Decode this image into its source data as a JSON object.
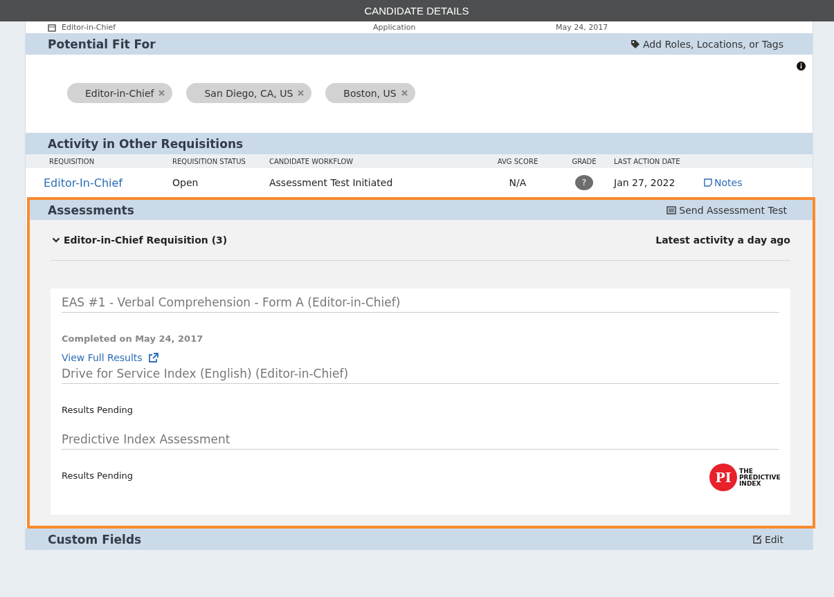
{
  "header": {
    "title": "CANDIDATE DETAILS"
  },
  "top_row": {
    "requisition": "Editor-in-Chief",
    "stage": "Application",
    "date": "May 24, 2017"
  },
  "potential_fit": {
    "title": "Potential Fit For",
    "action": "Add Roles, Locations, or Tags",
    "tags": [
      {
        "label": "Editor-in-Chief"
      },
      {
        "label": "San Diego, CA, US"
      },
      {
        "label": "Boston, US"
      }
    ]
  },
  "activity": {
    "title": "Activity in Other Requisitions",
    "columns": [
      "REQUISITION",
      "REQUISITION STATUS",
      "CANDIDATE WORKFLOW",
      "AVG SCORE",
      "GRADE",
      "LAST ACTION DATE"
    ],
    "rows": [
      {
        "requisition": "Editor-In-Chief",
        "status": "Open",
        "workflow": "Assessment Test Initiated",
        "avg_score": "N/A",
        "grade": "?",
        "last_action": "Jan 27, 2022",
        "notes": "Notes"
      }
    ]
  },
  "assessments": {
    "title": "Assessments",
    "action": "Send Assessment Test",
    "highlighted": true,
    "groups": [
      {
        "title": "Editor-in-Chief Requisition (3)",
        "expanded": true,
        "latest": "Latest activity a day ago",
        "items": [
          {
            "kind": "completed",
            "name": "EAS #1 - Verbal Comprehension - Form A (Editor-in-Chief)",
            "status": "Completed on May 24, 2017",
            "link": "View Full Results"
          },
          {
            "kind": "pending",
            "name": "Drive for Service Index (English) (Editor-in-Chief)",
            "status": "Results Pending"
          },
          {
            "kind": "pending",
            "name": "Predictive Index Assessment",
            "status": "Results Pending",
            "logo": {
              "mark": "PI",
              "text": "THE PREDICTIVE INDEX"
            }
          }
        ]
      }
    ]
  },
  "custom_fields": {
    "title": "Custom Fields",
    "action": "Edit"
  }
}
